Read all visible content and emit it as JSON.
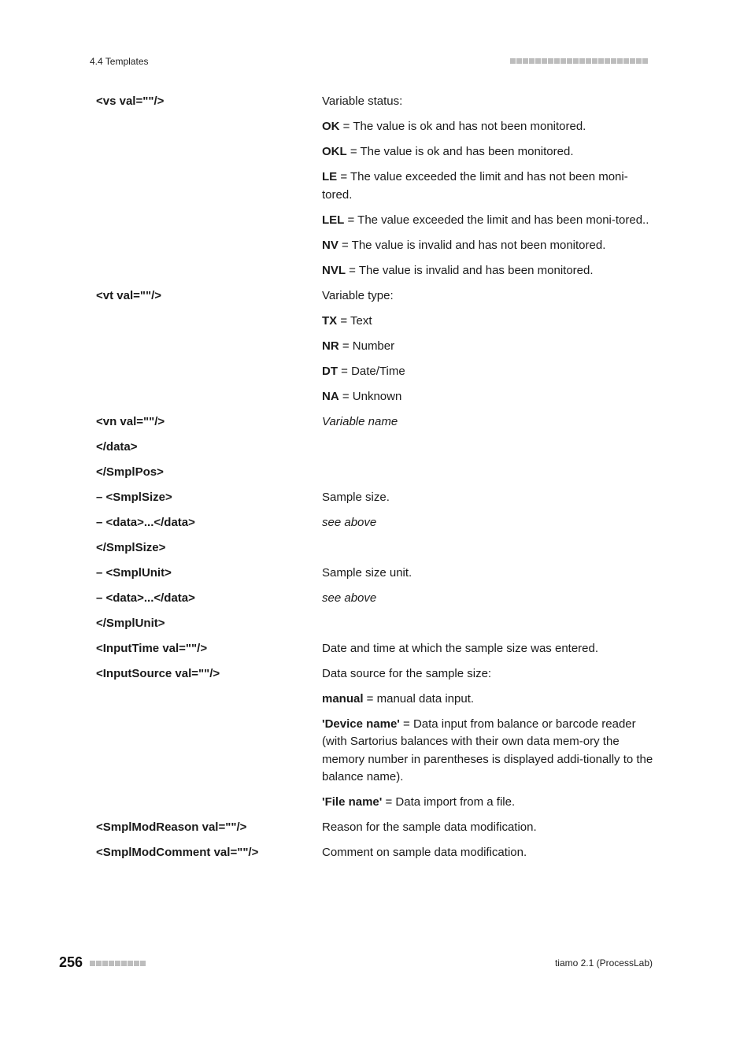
{
  "header": {
    "section": "4.4 Templates",
    "dot_count": 22
  },
  "rows": [
    {
      "term": "<vs val=\"\"/>",
      "desc": [
        {
          "bold": "",
          "text": "Variable status:",
          "italic": false
        },
        {
          "bold": "OK",
          "text": " = The value is ok and has not been monitored.",
          "italic": false
        },
        {
          "bold": "OKL",
          "text": " = The value is ok and has been monitored.",
          "italic": false
        },
        {
          "bold": "LE",
          "text": " = The value exceeded the limit and has not been moni-tored.",
          "italic": false
        },
        {
          "bold": "LEL",
          "text": " = The value exceeded the limit and has been moni-tored..",
          "italic": false
        },
        {
          "bold": "NV",
          "text": " = The value is invalid and has not been monitored.",
          "italic": false
        },
        {
          "bold": "NVL",
          "text": " = The value is invalid and has been monitored.",
          "italic": false
        }
      ]
    },
    {
      "term": "<vt val=\"\"/>",
      "desc": [
        {
          "bold": "",
          "text": "Variable type:",
          "italic": false
        },
        {
          "bold": "TX",
          "text": " = Text",
          "italic": false
        },
        {
          "bold": "NR",
          "text": " = Number",
          "italic": false
        },
        {
          "bold": "DT",
          "text": " = Date/Time",
          "italic": false
        },
        {
          "bold": "NA",
          "text": " = Unknown",
          "italic": false
        }
      ]
    },
    {
      "term": "<vn val=\"\"/>",
      "desc": [
        {
          "bold": "",
          "text": "Variable name",
          "italic": true
        }
      ]
    },
    {
      "term": "</data>",
      "desc": []
    },
    {
      "term": "</SmplPos>",
      "desc": []
    },
    {
      "term": "– <SmplSize>",
      "desc": [
        {
          "bold": "",
          "text": "Sample size.",
          "italic": false
        }
      ]
    },
    {
      "term": "– <data>...</data>",
      "desc": [
        {
          "bold": "",
          "text": "see above",
          "italic": true
        }
      ]
    },
    {
      "term": "</SmplSize>",
      "desc": []
    },
    {
      "term": "– <SmplUnit>",
      "desc": [
        {
          "bold": "",
          "text": "Sample size unit.",
          "italic": false
        }
      ]
    },
    {
      "term": "– <data>...</data>",
      "desc": [
        {
          "bold": "",
          "text": "see above",
          "italic": true
        }
      ]
    },
    {
      "term": "</SmplUnit>",
      "desc": []
    },
    {
      "term": "<InputTime val=\"\"/>",
      "desc": [
        {
          "bold": "",
          "text": "Date and time at which the sample size was entered.",
          "italic": false
        }
      ]
    },
    {
      "term": "<InputSource val=\"\"/>",
      "desc": [
        {
          "bold": "",
          "text": "Data source for the sample size:",
          "italic": false
        },
        {
          "bold": "manual",
          "text": " = manual data input.",
          "italic": false
        },
        {
          "bold": "'Device name'",
          "text": " = Data input from balance or barcode reader (with Sartorius balances with their own data mem-ory the memory number in parentheses is displayed addi-tionally to the balance name).",
          "italic": false
        },
        {
          "bold": "'File name'",
          "text": " = Data import from a file.",
          "italic": false
        }
      ]
    },
    {
      "term": "<SmplModReason val=\"\"/>",
      "desc": [
        {
          "bold": "",
          "text": "Reason for the sample data modification.",
          "italic": false
        }
      ]
    },
    {
      "term": "<SmplModComment val=\"\"/>",
      "desc": [
        {
          "bold": "",
          "text": "Comment on sample data modification.",
          "italic": false
        }
      ]
    }
  ],
  "footer": {
    "page_number": "256",
    "dot_count": 9,
    "product": "tiamo 2.1 (ProcessLab)"
  }
}
